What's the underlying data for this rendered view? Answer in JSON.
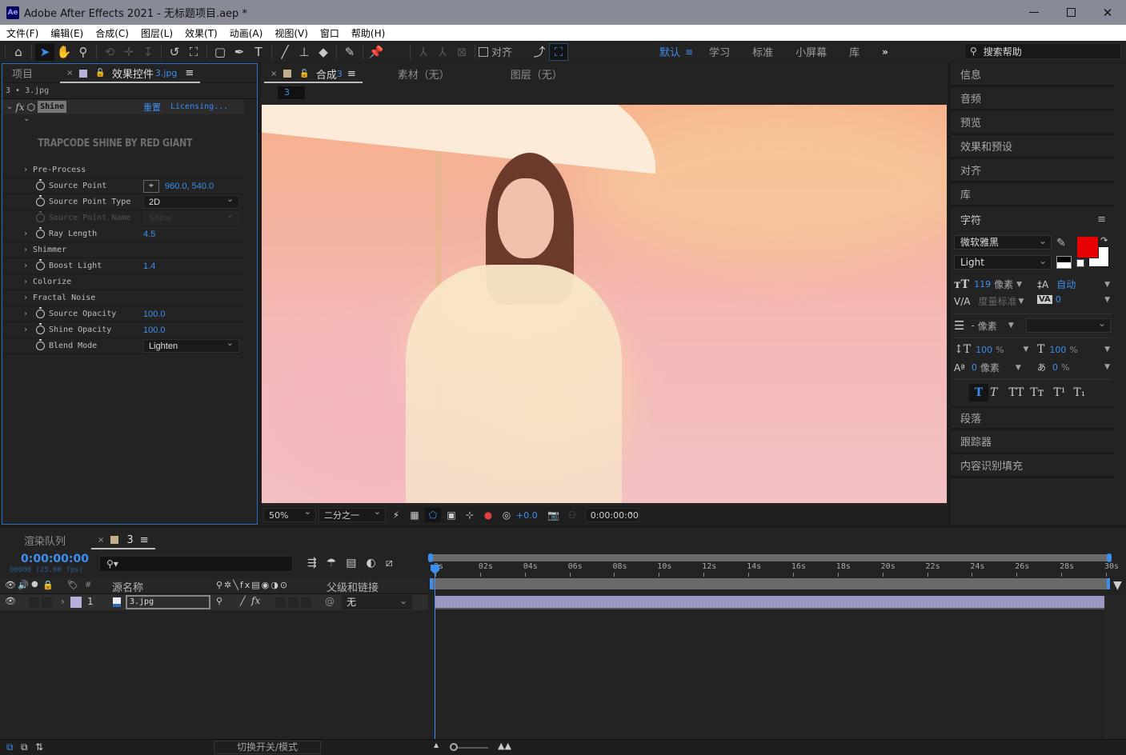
{
  "titlebar": {
    "app_icon": "Ae",
    "title": "Adobe After Effects 2021 - 无标题项目.aep *",
    "minimize": "—",
    "maximize": "☐",
    "close": "✕"
  },
  "menu": [
    "文件(F)",
    "编辑(E)",
    "合成(C)",
    "图层(L)",
    "效果(T)",
    "动画(A)",
    "视图(V)",
    "窗口",
    "帮助(H)"
  ],
  "toolbar": {
    "snap_label": "对齐",
    "workspaces": [
      "默认",
      "学习",
      "标准",
      "小屏幕",
      "库"
    ],
    "active_workspace": "默认",
    "more": "»",
    "search_placeholder": "搜索帮助"
  },
  "effects_panel": {
    "tab_project": "项目",
    "tab_effects": "效果控件",
    "tab_effects_file": "3.jpg",
    "breadcrumb": "3 • 3.jpg",
    "effect_name": "Shine",
    "reset_label": "重置",
    "licensing_label": "Licensing...",
    "banner": "TRAPCODE SHINE BY RED GIANT",
    "properties": [
      {
        "label": "Pre-Process",
        "type": "group"
      },
      {
        "label": "Source Point",
        "type": "point",
        "value": "960.0, 540.0"
      },
      {
        "label": "Source Point Type",
        "type": "dropdown",
        "value": "2D"
      },
      {
        "label": "Source Point Name",
        "type": "dropdown-disabled",
        "value": "Shine"
      },
      {
        "label": "Ray Length",
        "type": "number",
        "value": "4.5"
      },
      {
        "label": "Shimmer",
        "type": "group"
      },
      {
        "label": "Boost Light",
        "type": "number",
        "value": "1.4"
      },
      {
        "label": "Colorize",
        "type": "group"
      },
      {
        "label": "Fractal Noise",
        "type": "group"
      },
      {
        "label": "Source Opacity",
        "type": "number",
        "value": "100.0"
      },
      {
        "label": "Shine Opacity",
        "type": "number",
        "value": "100.0"
      },
      {
        "label": "Blend Mode",
        "type": "dropdown",
        "value": "Lighten"
      }
    ]
  },
  "comp_panel": {
    "tab_comp": "合成",
    "tab_comp_name": "3",
    "tab_footage": "素材（无）",
    "tab_layer": "图层（无）",
    "comp_flow_label": "3",
    "footer": {
      "zoom": "50%",
      "resolution": "二分之一",
      "exposure": "+0.0",
      "timecode": "0:00:00:00"
    }
  },
  "right_panel": {
    "sections_top": [
      "信息",
      "音频",
      "预览",
      "效果和预设",
      "对齐",
      "库"
    ],
    "character": {
      "title": "字符",
      "font_family": "微软雅黑",
      "font_style": "Light",
      "fill_color": "#e60000",
      "font_size": "119",
      "font_size_unit": "像素",
      "leading": "自动",
      "kerning": "度量标准",
      "tracking": "0",
      "stroke_width": "-",
      "stroke_unit": "像素",
      "vertical_scale": "100",
      "horizontal_scale": "100",
      "percent": "%",
      "baseline_shift": "0",
      "baseline_unit": "像素",
      "tsume": "0",
      "styles": [
        "T",
        "T",
        "TT",
        "Tт",
        "T¹",
        "T₁"
      ]
    },
    "sections_bottom": [
      "段落",
      "跟踪器",
      "内容识别填充"
    ]
  },
  "timeline": {
    "tab_render": "渲染队列",
    "tab_comp": "3",
    "timecode": "0:00:00:00",
    "frames_fps": "00000 (25.00 fps)",
    "search_placeholder": "",
    "col_source_name": "源名称",
    "col_hash": "#",
    "col_parent": "父级和链接",
    "ruler": [
      "0s",
      "02s",
      "04s",
      "06s",
      "08s",
      "10s",
      "12s",
      "14s",
      "16s",
      "18s",
      "20s",
      "22s",
      "24s",
      "26s",
      "28s",
      "30s"
    ],
    "layers": [
      {
        "index": "1",
        "name": "3.jpg",
        "parent": "无",
        "label_color": "#b4b2d8"
      }
    ],
    "footer_toggle": "切换开关/模式"
  },
  "colors": {
    "accent": "#3d8ef0",
    "panel": "#232323",
    "layer_bar": "#9d9bc6"
  }
}
